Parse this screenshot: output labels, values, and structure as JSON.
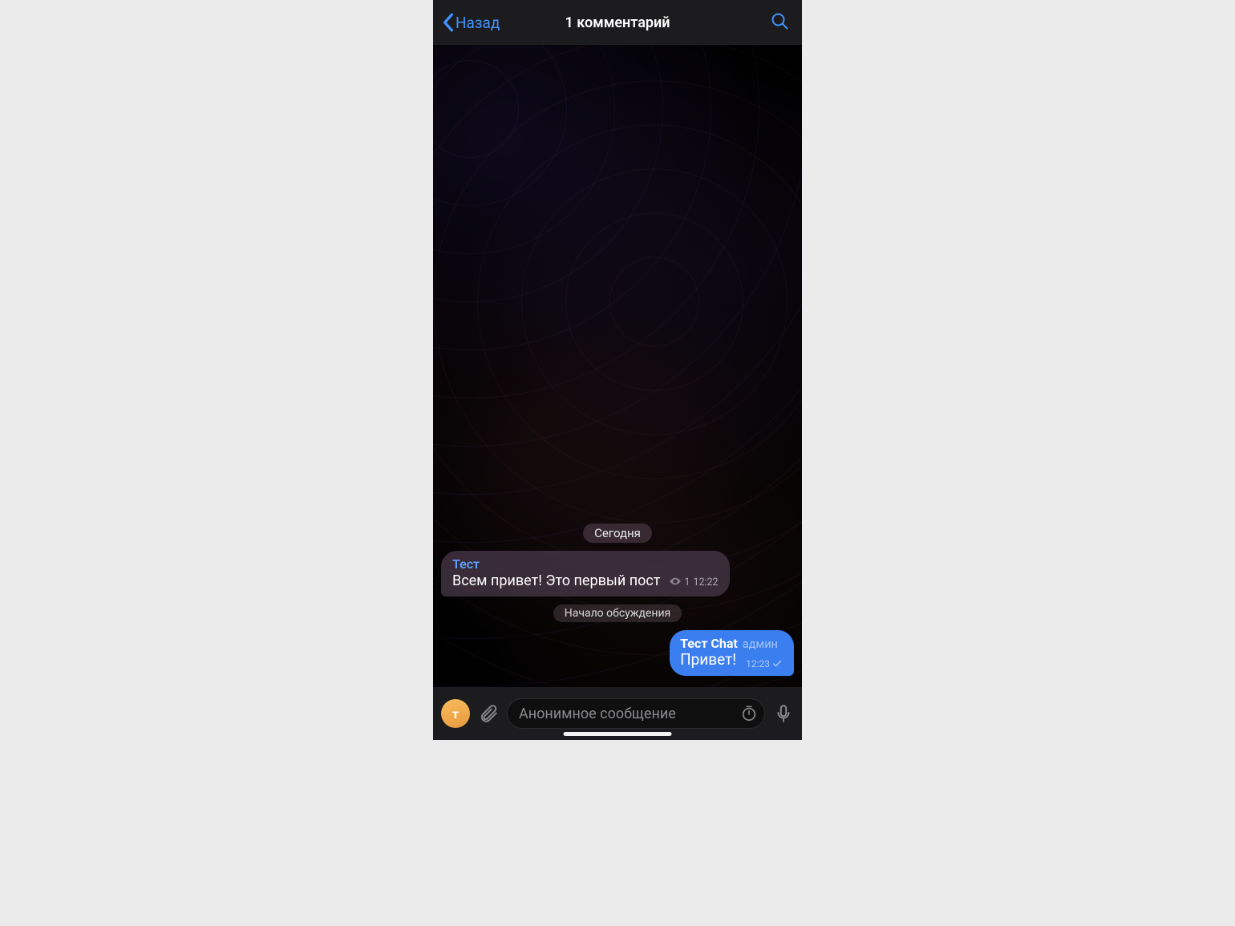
{
  "header": {
    "back_label": "Назад",
    "title": "1 комментарий"
  },
  "chat": {
    "date_label": "Сегодня",
    "discussion_start_label": "Начало обсуждения",
    "incoming": {
      "sender": "Тест",
      "text": "Всем привет! Это первый пост",
      "views": "1",
      "time": "12:22"
    },
    "outgoing": {
      "sender": "Тест Chat",
      "role": "админ",
      "text": "Привет!",
      "time": "12:23"
    }
  },
  "input": {
    "avatar_initial": "т",
    "placeholder": "Анонимное сообщение"
  }
}
